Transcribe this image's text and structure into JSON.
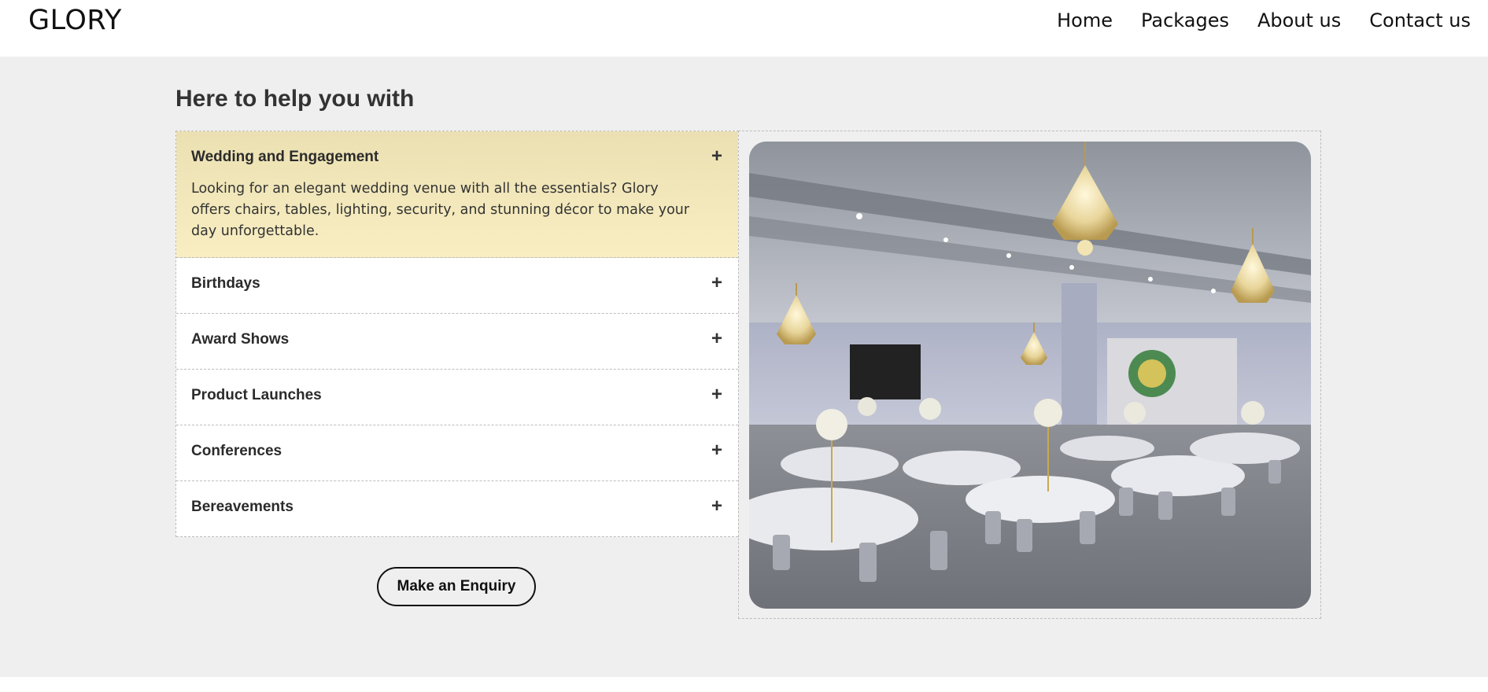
{
  "header": {
    "logo": "GLORY",
    "nav": [
      "Home",
      "Packages",
      "About us",
      "Contact us"
    ]
  },
  "section": {
    "heading": "Here to help you with",
    "accordion": [
      {
        "title": "Wedding and Engagement",
        "open": true,
        "body": "Looking for an elegant wedding venue with all the essentials? Glory offers chairs, tables, lighting, security, and stunning décor to make your day unforgettable."
      },
      {
        "title": "Birthdays",
        "open": false
      },
      {
        "title": "Award Shows",
        "open": false
      },
      {
        "title": "Product Launches",
        "open": false
      },
      {
        "title": "Conferences",
        "open": false
      },
      {
        "title": "Bereavements",
        "open": false
      }
    ],
    "expand_icon": "+",
    "cta_label": "Make an Enquiry"
  },
  "colors": {
    "page_bg": "#efefef",
    "active_item_bg": "#f3e8bb",
    "text": "#2b2b2b"
  }
}
